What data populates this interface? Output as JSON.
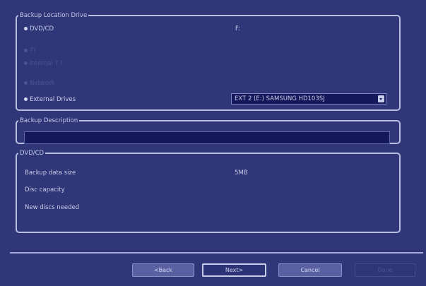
{
  "location": {
    "legend": "Backup Location Drive",
    "options": {
      "dvd": "DVD/CD",
      "a": "??",
      "b": "Internal ? ?",
      "c": "Network",
      "ext": "External Drives"
    },
    "drive_letter": "F:",
    "drive_select_value": "EXT 2 (E:) SAMSUNG HD103SJ"
  },
  "description": {
    "legend": "Backup Description",
    "value": ""
  },
  "dvd_section": {
    "legend": "DVD/CD",
    "rows": [
      {
        "label": "Backup data size",
        "value": "5MB"
      },
      {
        "label": "Disc capacity",
        "value": ""
      },
      {
        "label": "New discs needed",
        "value": ""
      }
    ]
  },
  "buttons": {
    "back": "<Back",
    "next": "Next>",
    "cancel": "Cancel",
    "done": "Done"
  }
}
